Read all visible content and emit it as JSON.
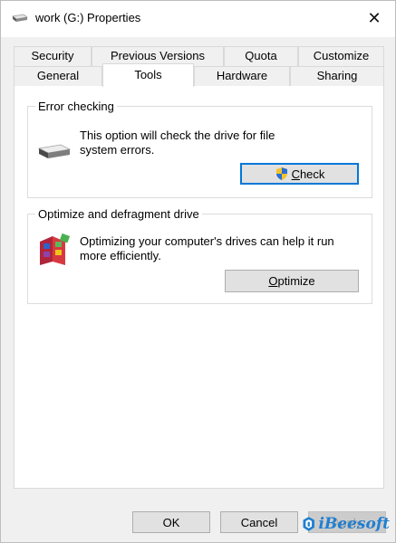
{
  "window": {
    "title": "work (G:) Properties",
    "close_glyph": "✕",
    "icon": "drive-icon"
  },
  "tabs": {
    "row1": [
      "Security",
      "Previous Versions",
      "Quota",
      "Customize"
    ],
    "row2": [
      "General",
      "Tools",
      "Hardware",
      "Sharing"
    ],
    "active": "Tools"
  },
  "error_checking": {
    "title": "Error checking",
    "description_line1": "This option will check the drive for file",
    "description_line2": "system errors.",
    "button_mnemonic": "C",
    "button_rest": "heck",
    "icon": "drive-icon",
    "button_icon": "uac-shield-icon"
  },
  "optimize": {
    "title": "Optimize and defragment drive",
    "description_line1": "Optimizing your computer's drives can help it run",
    "description_line2": "more efficiently.",
    "button_mnemonic": "O",
    "button_rest": "ptimize",
    "icon": "defrag-icon"
  },
  "footer": {
    "ok": "OK",
    "cancel": "Cancel",
    "apply": "Apply"
  },
  "watermark": {
    "text": "iBeesoft",
    "icon": "ibeesoft-logo-icon"
  },
  "colors": {
    "focus_border": "#0078d7",
    "window_bg": "#f0f0f0",
    "panel_bg": "#ffffff",
    "brand_blue": "#1f7fd0"
  }
}
